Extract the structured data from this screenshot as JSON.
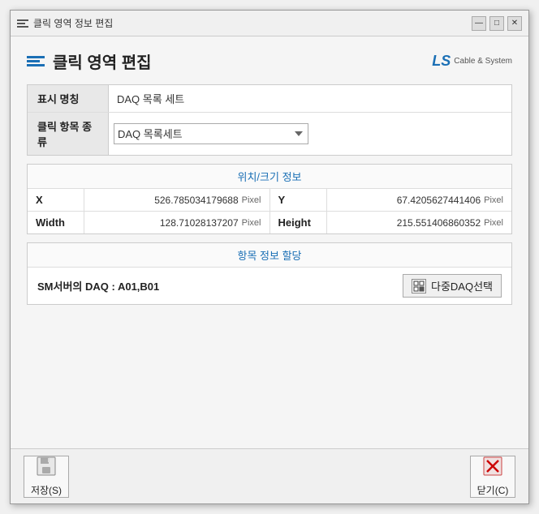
{
  "window": {
    "title": "클릭 영역 정보 편집",
    "page_title": "클릭 영역 편집"
  },
  "title_controls": {
    "minimize": "—",
    "maximize": "□",
    "close": "✕"
  },
  "logo": {
    "text": "LS",
    "sub": "Cable & System"
  },
  "form": {
    "display_label": "표시 명칭",
    "display_value": "DAQ 목록 세트",
    "click_type_label": "클릭 항목 종류",
    "click_type_value": "DAQ 목록세트",
    "click_type_options": [
      "DAQ 목록세트"
    ]
  },
  "position_section": {
    "title": "위치/크기 정보",
    "x_label": "X",
    "x_value": "526.785034179688",
    "x_unit": "Pixel",
    "y_label": "Y",
    "y_value": "67.4205627441406",
    "y_unit": "Pixel",
    "width_label": "Width",
    "width_value": "128.71028137207",
    "width_unit": "Pixel",
    "height_label": "Height",
    "height_value": "215.551406860352",
    "height_unit": "Pixel"
  },
  "item_section": {
    "title": "항목 정보 할당",
    "sm_label": "SM서버의 DAQ : A01,B01",
    "daq_btn_label": "다중DAQ선택"
  },
  "footer": {
    "save_label": "저장(S)",
    "close_label": "닫기(C)"
  }
}
